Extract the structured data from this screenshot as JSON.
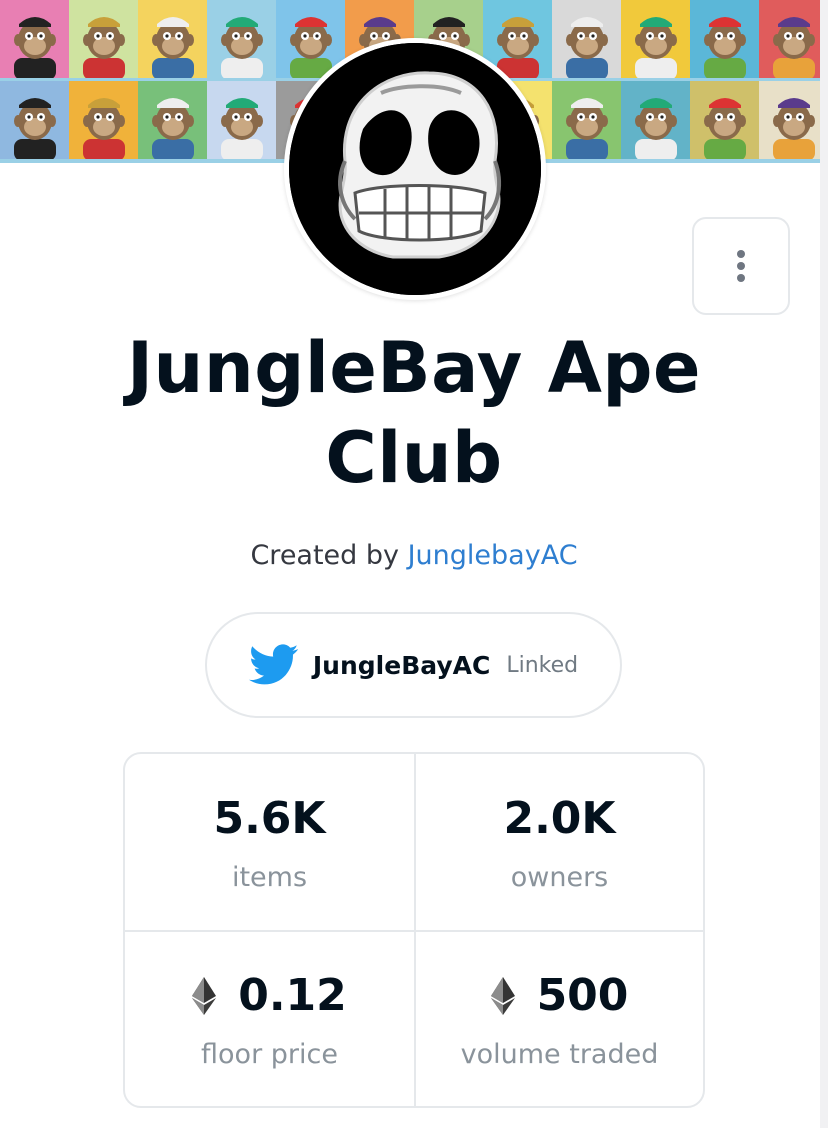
{
  "collection": {
    "name": "JungleBay Ape Club",
    "created_prefix": "Created by ",
    "creator": "JunglebayAC"
  },
  "social": {
    "icon": "twitter-icon",
    "handle": "JungleBayAC",
    "status": "Linked"
  },
  "menu": {
    "icon": "more-vertical-icon"
  },
  "stats": {
    "items": {
      "value": "5.6K",
      "label": "items"
    },
    "owners": {
      "value": "2.0K",
      "label": "owners"
    },
    "floor_price": {
      "value": "0.12",
      "label": "floor price",
      "icon": "ethereum-icon"
    },
    "volume_traded": {
      "value": "500",
      "label": "volume traded",
      "icon": "ethereum-icon"
    }
  },
  "colors": {
    "link": "#2e7ed0",
    "text": "#04111d",
    "muted": "#8a939b",
    "border": "#e5e8eb",
    "twitter": "#1d9bf0"
  },
  "banner": {
    "tiles": [
      "#e87fb3",
      "#cfe3a0",
      "#f4d35e",
      "#9ad0e6",
      "#7fc4ea",
      "#f29c4b",
      "#a7d08c",
      "#6fc6e0",
      "#d9d9d9",
      "#f1c93b",
      "#5bb7d8",
      "#e05c5c",
      "#8fb8e0",
      "#f0b23a",
      "#78c07a",
      "#c7d8ef",
      "#9b9b9b",
      "#e9b9c8",
      "#7fd0c8",
      "#f4e26e",
      "#88c56f",
      "#62b3c8",
      "#cfc06a",
      "#e8e0c8"
    ]
  }
}
